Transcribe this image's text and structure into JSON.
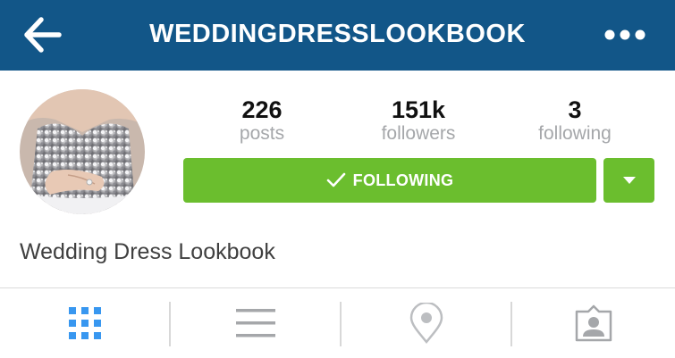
{
  "header": {
    "title": "WEDDINGDRESSLOOKBOOK",
    "back_icon": "arrow-left-icon",
    "more_icon": "more-horizontal-icon",
    "background": "#125688"
  },
  "profile": {
    "avatar_icon": "profile-photo",
    "full_name": "Wedding Dress Lookbook",
    "stats": [
      {
        "value": "226",
        "label": "posts"
      },
      {
        "value": "151k",
        "label": "followers"
      },
      {
        "value": "3",
        "label": "following"
      }
    ],
    "follow_button": {
      "label": "FOLLOWING",
      "icon": "checkmark-icon",
      "color": "#6bbe2e"
    },
    "dropdown_icon": "caret-down-icon"
  },
  "tabs": [
    {
      "icon": "grid-icon",
      "active": true,
      "color": "#3897f0"
    },
    {
      "icon": "list-icon",
      "active": false,
      "color": "#a5a7aa"
    },
    {
      "icon": "location-pin-icon",
      "active": false,
      "color": "#a5a7aa"
    },
    {
      "icon": "tagged-person-icon",
      "active": false,
      "color": "#a5a7aa"
    }
  ]
}
